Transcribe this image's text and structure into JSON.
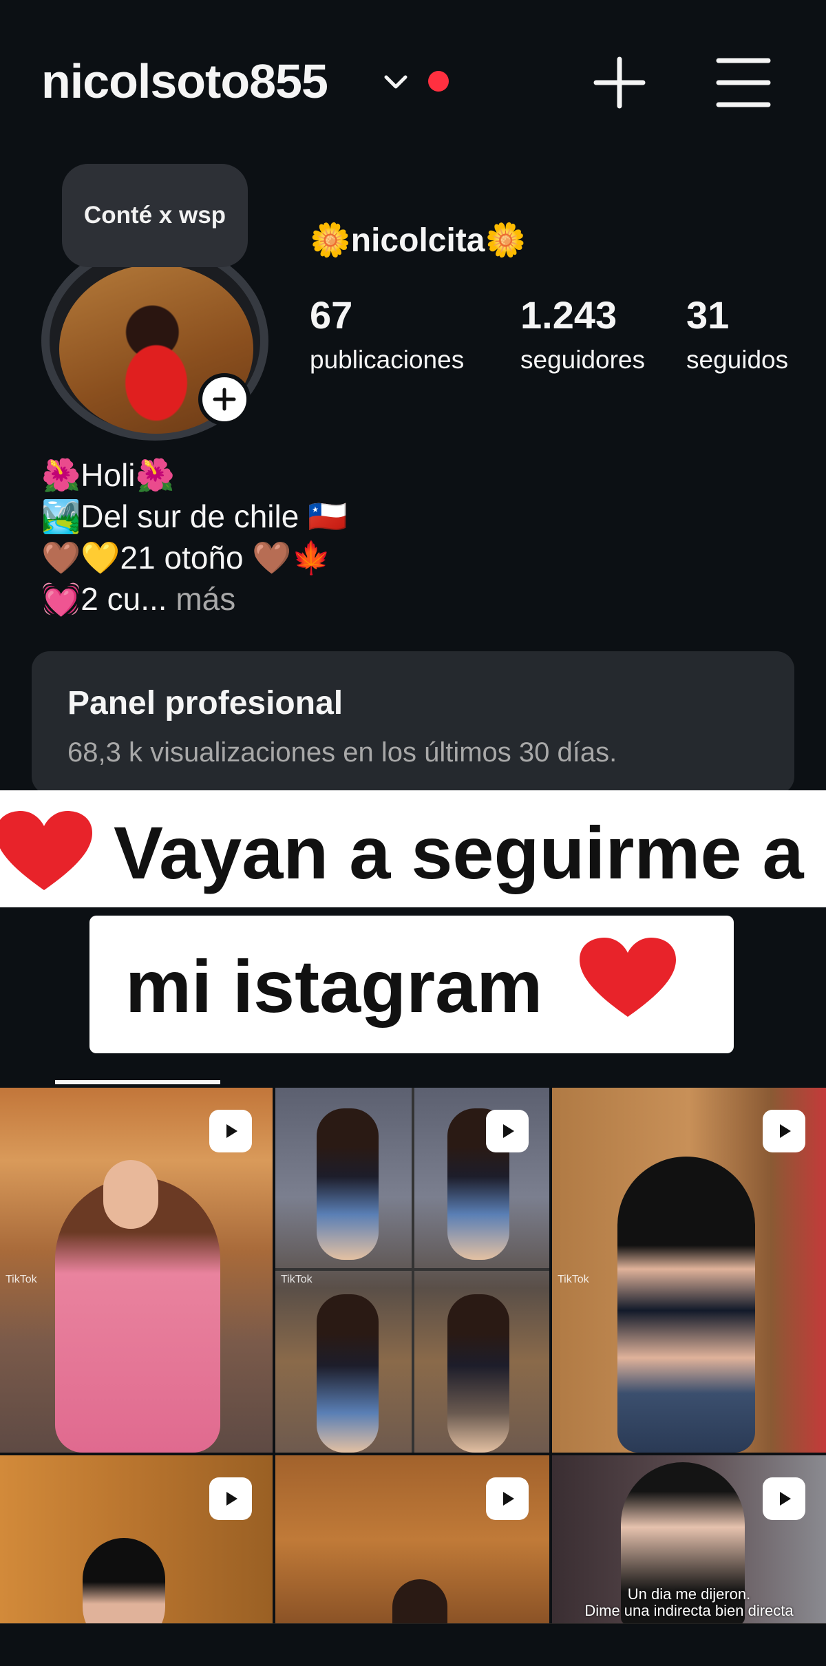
{
  "header": {
    "username": "nicolsoto855",
    "chevron_icon": "chevron-down-icon",
    "notification_color": "#ff3040",
    "create_icon": "plus-icon",
    "menu_icon": "hamburger-menu-icon"
  },
  "profile": {
    "note": "Conté x wsp",
    "display_name": "🌼nicolcita🌼",
    "stats": [
      {
        "value": "67",
        "label": "publicaciones"
      },
      {
        "value": "1.243",
        "label": "seguidores"
      },
      {
        "value": "31",
        "label": "seguidos"
      }
    ],
    "bio": {
      "line1": "🌺Holi🌺",
      "line2": "🏞️Del sur de chile 🇨🇱",
      "line3": "🤎💛21 otoño 🤎🍁",
      "line4": "💓2 cu...",
      "more": " más"
    }
  },
  "panel": {
    "title": "Panel profesional",
    "subtitle": "68,3 k visualizaciones en los últimos 30 días."
  },
  "overlay": {
    "line1": "Vayan a seguirme a",
    "line2": "mi istagram",
    "heart_color": "#e8232a"
  },
  "grid": {
    "reel_icon": "reels-play-icon",
    "tiktok_label": "TikTok",
    "caption_last": "Un dia me dijeron.\nDime una indirecta bien directa"
  },
  "colors": {
    "background": "#0c1014",
    "panel": "#25292e",
    "accent_red": "#ff3040"
  }
}
